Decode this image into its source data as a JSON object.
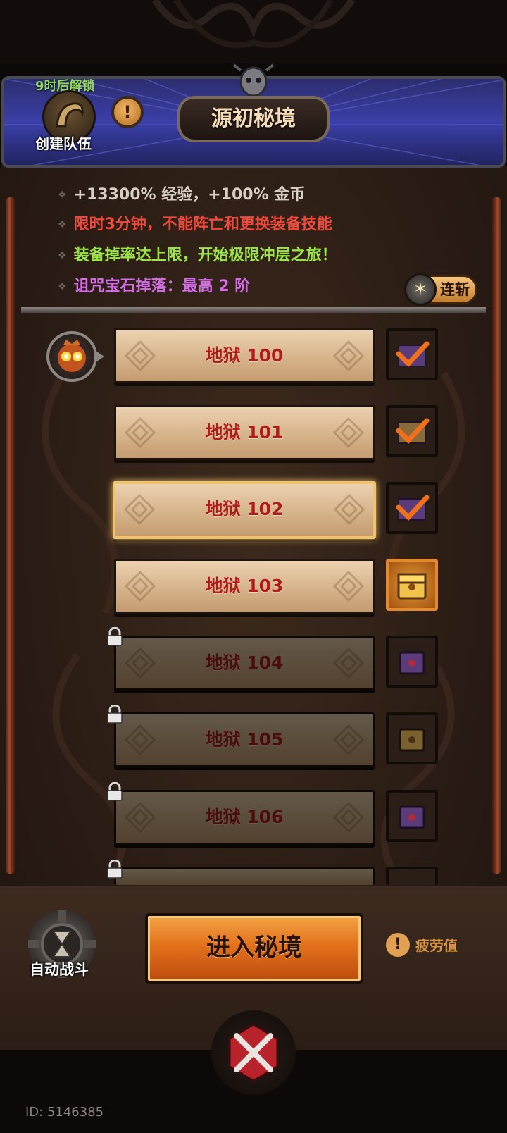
{
  "header": {
    "unlock_text": "9时后解锁",
    "team_label": "创建队伍",
    "title": "源初秘境",
    "info_icon": "!"
  },
  "buffs": [
    "+13300% 经验，+100% 金币",
    "限时3分钟，不能阵亡和更换装备技能",
    "装备掉率达上限，开始极限冲层之旅！",
    "诅咒宝石掉落：最高 2 阶"
  ],
  "lianzhan": {
    "label": "连斩",
    "icon": "✶"
  },
  "levels": [
    {
      "label": "地狱 100",
      "state": "completed"
    },
    {
      "label": "地狱 101",
      "state": "completed"
    },
    {
      "label": "地狱 102",
      "state": "completed-selected"
    },
    {
      "label": "地狱 103",
      "state": "available"
    },
    {
      "label": "地狱 104",
      "state": "locked"
    },
    {
      "label": "地狱 105",
      "state": "locked"
    },
    {
      "label": "地狱 106",
      "state": "locked"
    },
    {
      "label": "",
      "state": "locked"
    }
  ],
  "bottom": {
    "enter_label": "进入秘境",
    "auto_label": "自动战斗",
    "fatigue_label": "疲劳值",
    "fatigue_icon": "!"
  },
  "footer": {
    "id_text": "ID: 5146385"
  },
  "colors": {
    "completed_check": "#f0701c",
    "level_text": "#b01c1c",
    "buff_red": "#f0483a",
    "buff_green": "#9be648",
    "buff_purple": "#d36ee6",
    "selected_border": "#f1c36a"
  }
}
